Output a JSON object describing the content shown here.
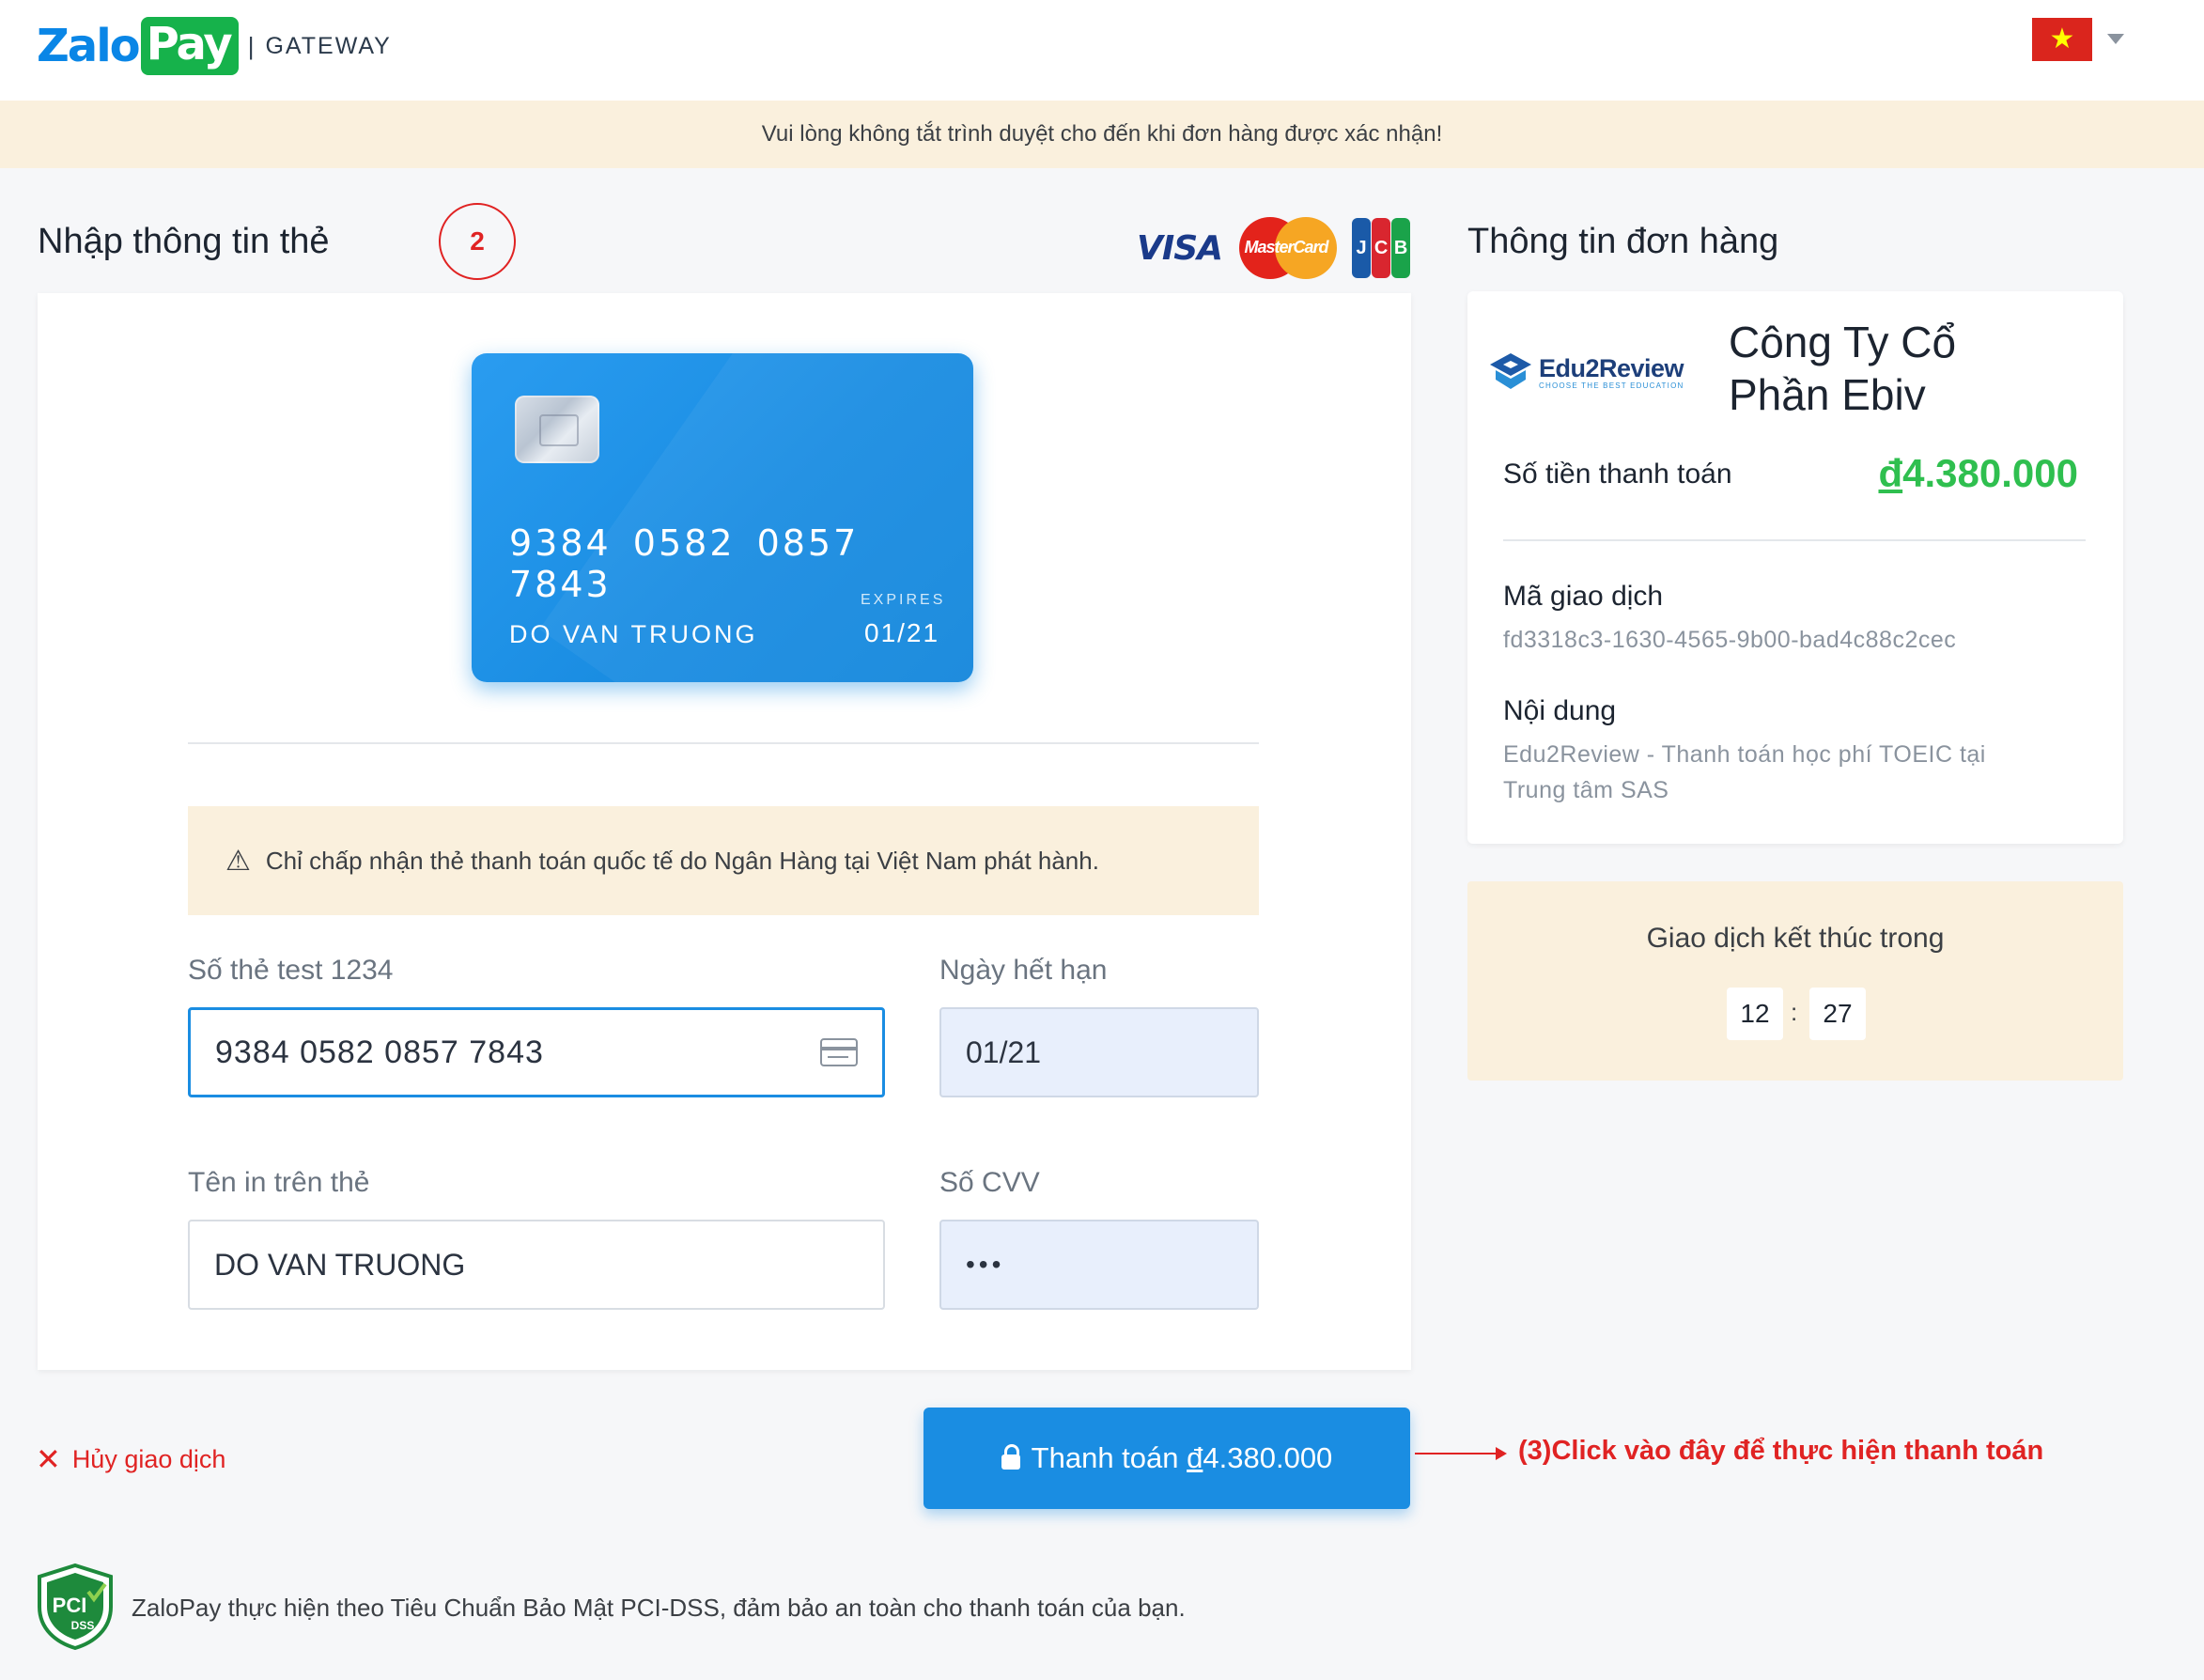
{
  "header": {
    "logo_zalo": "Zalo",
    "logo_pay": "Pay",
    "separator": "|",
    "gateway": "GATEWAY",
    "language_flag_icon": "vietnam-flag-icon",
    "flag_star": "★"
  },
  "notice": "Vui lòng không tắt trình duyệt cho đến khi đơn hàng được xác nhận!",
  "card_section": {
    "title": "Nhập thông tin thẻ",
    "step_marker": "2",
    "brands": {
      "visa": "VISA",
      "mastercard": "MasterCard",
      "jcb": [
        "J",
        "C",
        "B"
      ]
    },
    "card_preview": {
      "number": "9384 0582 0857 7843",
      "holder": "DO VAN TRUONG",
      "expires_label": "EXPIRES",
      "expires": "01/21"
    },
    "warning": "Chỉ chấp nhận thẻ thanh toán quốc tế do Ngân Hàng tại Việt Nam phát hành.",
    "warning_icon": "⚠",
    "fields": {
      "card_number_label": "Số thẻ test 1234",
      "card_number_value": "9384 0582 0857 7843",
      "expiry_label": "Ngày hết hạn",
      "expiry_value": "01/21",
      "name_label": "Tên in trên thẻ",
      "name_value": "DO VAN TRUONG",
      "cvv_label": "Số CVV",
      "cvv_value": "•••"
    }
  },
  "actions": {
    "cancel_icon": "✕",
    "cancel_label": "Hủy giao dịch",
    "pay_prefix": "Thanh toán ",
    "pay_currency": "đ",
    "pay_amount": "4.380.000",
    "annotation": "(3)Click vào đây để thực hiện thanh toán"
  },
  "footer": {
    "pci_label": "PCI",
    "dss_label": "DSS",
    "text": "ZaloPay thực hiện theo Tiêu Chuẩn Bảo Mật PCI-DSS, đảm bảo an toàn cho thanh toán của bạn."
  },
  "order": {
    "title": "Thông tin đơn hàng",
    "merchant_logo_name": "Edu2Review",
    "merchant_logo_tagline": "CHOOSE THE BEST EDUCATION",
    "company_line1": "Công Ty Cổ",
    "company_line2": "Phần Ebiv",
    "amount_label": "Số tiền thanh toán",
    "amount_currency": "đ",
    "amount_value": "4.380.000",
    "txn_label": "Mã giao dịch",
    "txn_value": "fd3318c3-1630-4565-9b00-bad4c88c2cec",
    "content_label": "Nội dung",
    "content_line1": "Edu2Review - Thanh toán học phí TOEIC tại",
    "content_line2": "Trung tâm SAS"
  },
  "timer": {
    "title": "Giao dịch kết thúc trong",
    "minutes": "12",
    "separator": ":",
    "seconds": "27"
  },
  "colors": {
    "brand_blue": "#1a8de2",
    "brand_green": "#16b24b",
    "amount_green": "#2fbf4f",
    "alert_red": "#e02323",
    "notice_bg": "#faf0dd"
  }
}
